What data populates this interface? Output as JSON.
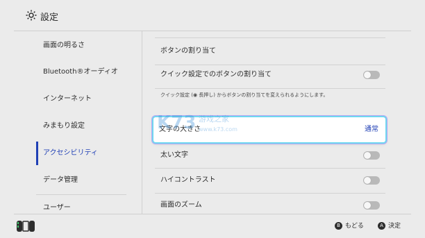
{
  "header": {
    "title": "設定",
    "icon": "gear-icon"
  },
  "sidebar": {
    "items": [
      {
        "label": "画面の明るさ",
        "active": false
      },
      {
        "label": "Bluetooth®オーディオ",
        "active": false
      },
      {
        "label": "インターネット",
        "active": false
      },
      {
        "label": "みまもり設定",
        "active": false
      },
      {
        "label": "アクセシビリティ",
        "active": true
      },
      {
        "label": "データ管理",
        "active": false
      },
      {
        "label": "ユーザー",
        "active": false
      }
    ]
  },
  "content": {
    "rows": [
      {
        "label": "ボタンの割り当て",
        "type": "link"
      },
      {
        "label": "クイック設定でのボタンの割り当て",
        "type": "toggle",
        "on": false
      },
      {
        "label": "文字の大きさ",
        "type": "select",
        "value": "通常",
        "focused": true
      },
      {
        "label": "太い文字",
        "type": "toggle",
        "on": false
      },
      {
        "label": "ハイコントラスト",
        "type": "toggle",
        "on": false
      },
      {
        "label": "画面のズーム",
        "type": "toggle",
        "on": false
      }
    ],
    "note": "クイック設定 (◉ 長押し) からボタンの割り当てを変えられるようにします。"
  },
  "watermark": {
    "text": "K73",
    "subtext": "游戏之家",
    "url": "www.k73.com"
  },
  "footer": {
    "controller_icon": "joycon-icon",
    "hints": [
      {
        "button": "B",
        "label": "もどる"
      },
      {
        "button": "A",
        "label": "決定"
      }
    ]
  },
  "colors": {
    "background": "#ebebeb",
    "accent": "#1f3fb5",
    "focus_glow": "#6fd7f0",
    "toggle_off": "#b9b9b9"
  }
}
